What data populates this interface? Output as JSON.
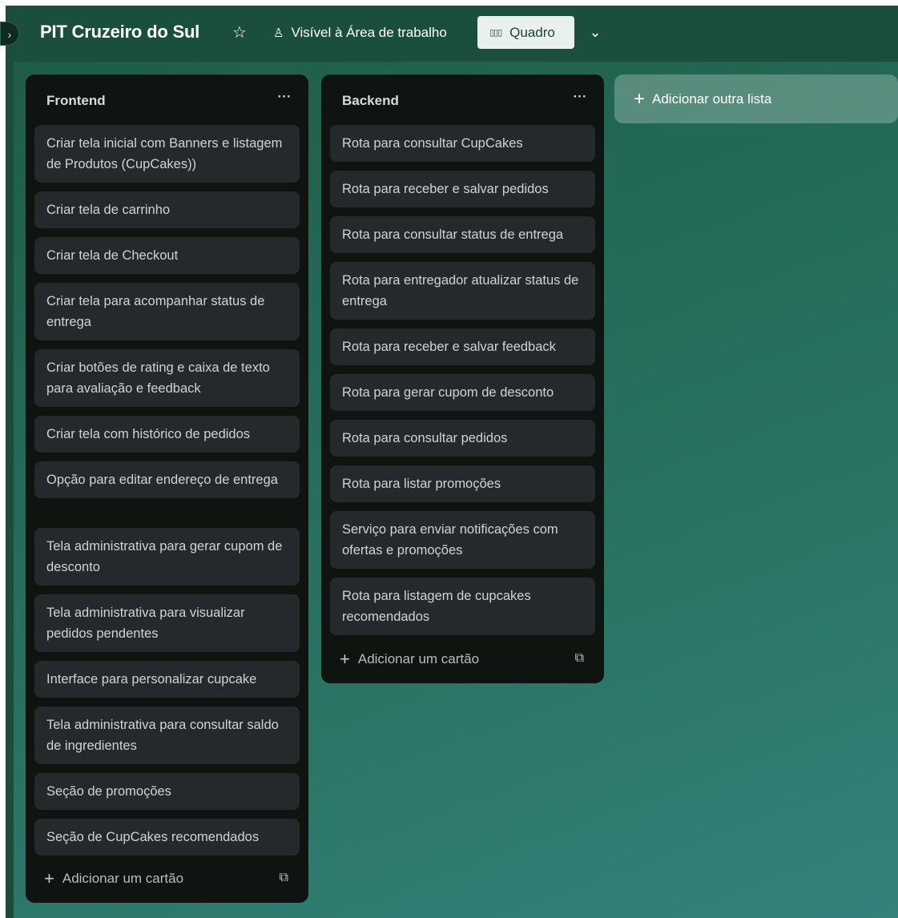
{
  "board": {
    "title": "PIT Cruzeiro do Sul",
    "star_icon": "star-icon",
    "visibility_label": "Visível à Área de trabalho",
    "view_label": "Quadro",
    "gradient_colors": [
      "#1f5a46",
      "#33827b"
    ]
  },
  "lists": [
    {
      "title": "Frontend",
      "cards": [
        "Criar tela inicial com Banners e listagem de Produtos (CupCakes))",
        "Criar tela de carrinho",
        "Criar tela de Checkout",
        "Criar tela para acompanhar status de entrega",
        "Criar botões de rating e caixa de texto para avaliação e feedback",
        "Criar tela com histórico de pedidos",
        "Opção para editar endereço de entrega",
        "Tela administrativa para gerar cupom de desconto",
        "Tela administrativa para visualizar pedidos pendentes",
        "Interface para personalizar cupcake",
        "Tela administrativa para consultar saldo de ingredientes",
        "Seção de promoções",
        "Seção de CupCakes recomendados"
      ],
      "add_card_label": "Adicionar um cartão"
    },
    {
      "title": "Backend",
      "cards": [
        "Rota para consultar CupCakes",
        "Rota para receber e salvar pedidos",
        "Rota para consultar status de entrega",
        "Rota para entregador atualizar status de entrega",
        "Rota para receber e salvar feedback",
        "Rota para gerar cupom de desconto",
        "Rota para consultar pedidos",
        "Rota para listar promoções",
        "Serviço para enviar notificações com ofertas e promoções",
        "Rota para listagem de cupcakes recomendados"
      ],
      "add_card_label": "Adicionar um cartão"
    }
  ],
  "add_list_label": "Adicionar outra lista"
}
